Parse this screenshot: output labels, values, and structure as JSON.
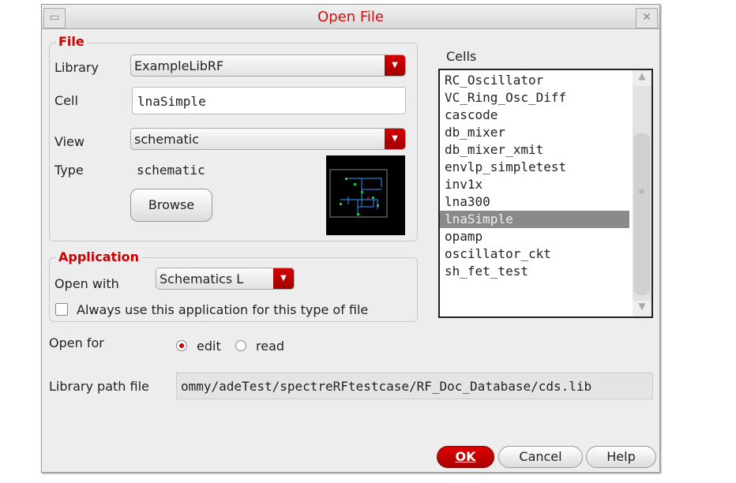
{
  "window": {
    "title": "Open File"
  },
  "file_group": {
    "legend": "File",
    "library_label": "Library",
    "library_value": "ExampleLibRF",
    "cell_label": "Cell",
    "cell_value": "lnaSimple",
    "view_label": "View",
    "view_value": "schematic",
    "type_label": "Type",
    "type_value": "schematic",
    "browse_label": "Browse"
  },
  "application_group": {
    "legend": "Application",
    "open_with_label": "Open with",
    "open_with_value": "Schematics L",
    "always_use_label": "Always use this application for this type of file",
    "always_use_checked": false
  },
  "cells": {
    "label": "Cells",
    "items": [
      "RC_Oscillator",
      "VC_Ring_Osc_Diff",
      "cascode",
      "db_mixer",
      "db_mixer_xmit",
      "envlp_simpletest",
      "inv1x",
      "lna300",
      "lnaSimple",
      "opamp",
      "oscillator_ckt",
      "sh_fet_test"
    ],
    "selected": "lnaSimple"
  },
  "open_for": {
    "label": "Open for",
    "options": [
      "edit",
      "read"
    ],
    "selected": "edit"
  },
  "library_path": {
    "label": "Library path file",
    "value": "ommy/adeTest/spectreRFtestcase/RF_Doc_Database/cds.lib"
  },
  "buttons": {
    "ok": "OK",
    "cancel": "Cancel",
    "help": "Help"
  },
  "colors": {
    "accent": "#c00000",
    "selection": "#8a8a8a"
  }
}
